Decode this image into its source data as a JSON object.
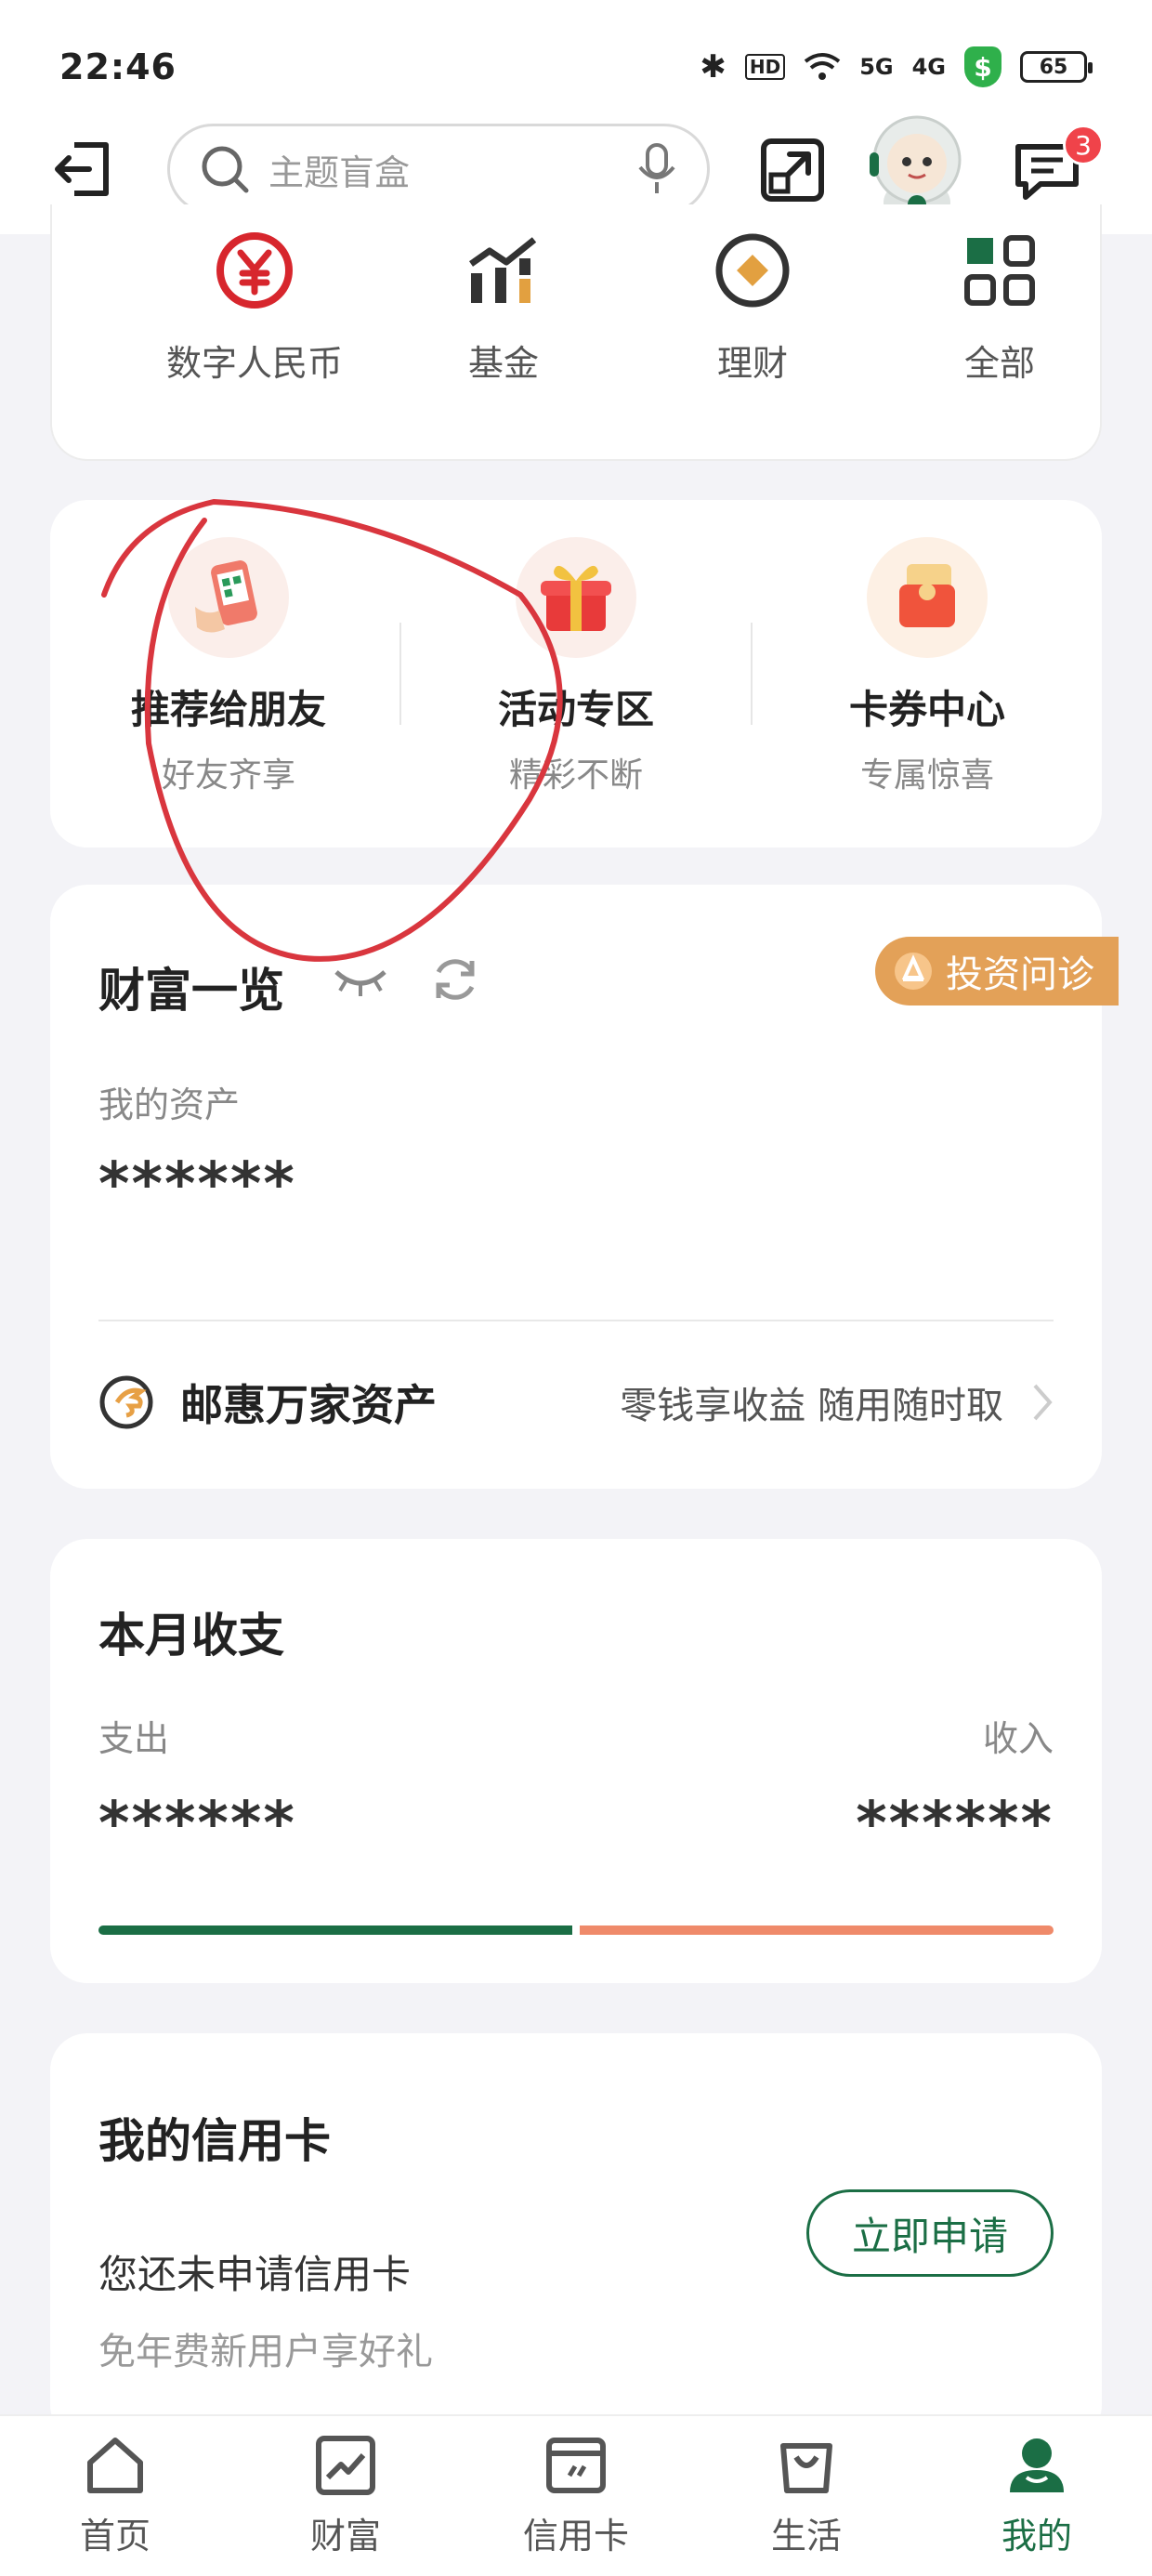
{
  "status_bar": {
    "time": "22:46",
    "bluetooth": "✱",
    "hd": "HD",
    "wifi": "wifi",
    "signal_1": "5G",
    "signal_2": "4G",
    "shield": "$",
    "battery": "65"
  },
  "header": {
    "search_placeholder": "主题盲盒",
    "message_badge": "3"
  },
  "categories": [
    {
      "label": "数字人民币",
      "icon": "yuan-icon"
    },
    {
      "label": "基金",
      "icon": "fund-chart-icon"
    },
    {
      "label": "理财",
      "icon": "finance-circle-icon"
    },
    {
      "label": "全部",
      "icon": "grid-icon"
    }
  ],
  "promos": [
    {
      "title": "推荐给朋友",
      "subtitle": "好友齐享"
    },
    {
      "title": "活动专区",
      "subtitle": "精彩不断"
    },
    {
      "title": "卡券中心",
      "subtitle": "专属惊喜"
    }
  ],
  "wealth": {
    "title": "财富一览",
    "advisor_label": "投资问诊",
    "assets_label": "我的资产",
    "assets_value": "******",
    "fund_name": "邮惠万家资产",
    "fund_desc": "零钱享收益 随用随时取"
  },
  "monthly": {
    "title": "本月收支",
    "expense_label": "支出",
    "income_label": "收入",
    "expense_value": "******",
    "income_value": "******",
    "expense_ratio": 0.5,
    "colors": {
      "expense": "#1b6e45",
      "income": "#ef8a6a"
    }
  },
  "credit": {
    "title": "我的信用卡",
    "status": "您还未申请信用卡",
    "promo": "免年费新用户享好礼",
    "apply_label": "立即申请"
  },
  "tabbar": [
    {
      "label": "首页",
      "icon": "home-icon",
      "active": false
    },
    {
      "label": "财富",
      "icon": "wealth-chart-icon",
      "active": false
    },
    {
      "label": "信用卡",
      "icon": "credit-card-icon",
      "active": false
    },
    {
      "label": "生活",
      "icon": "shopping-bag-icon",
      "active": false
    },
    {
      "label": "我的",
      "icon": "profile-icon",
      "active": true
    }
  ],
  "colors": {
    "brand_green": "#1b6e45",
    "brand_red": "#d7262d",
    "advisor_orange": "#e0a05a",
    "annotation_red": "#d9363e"
  }
}
